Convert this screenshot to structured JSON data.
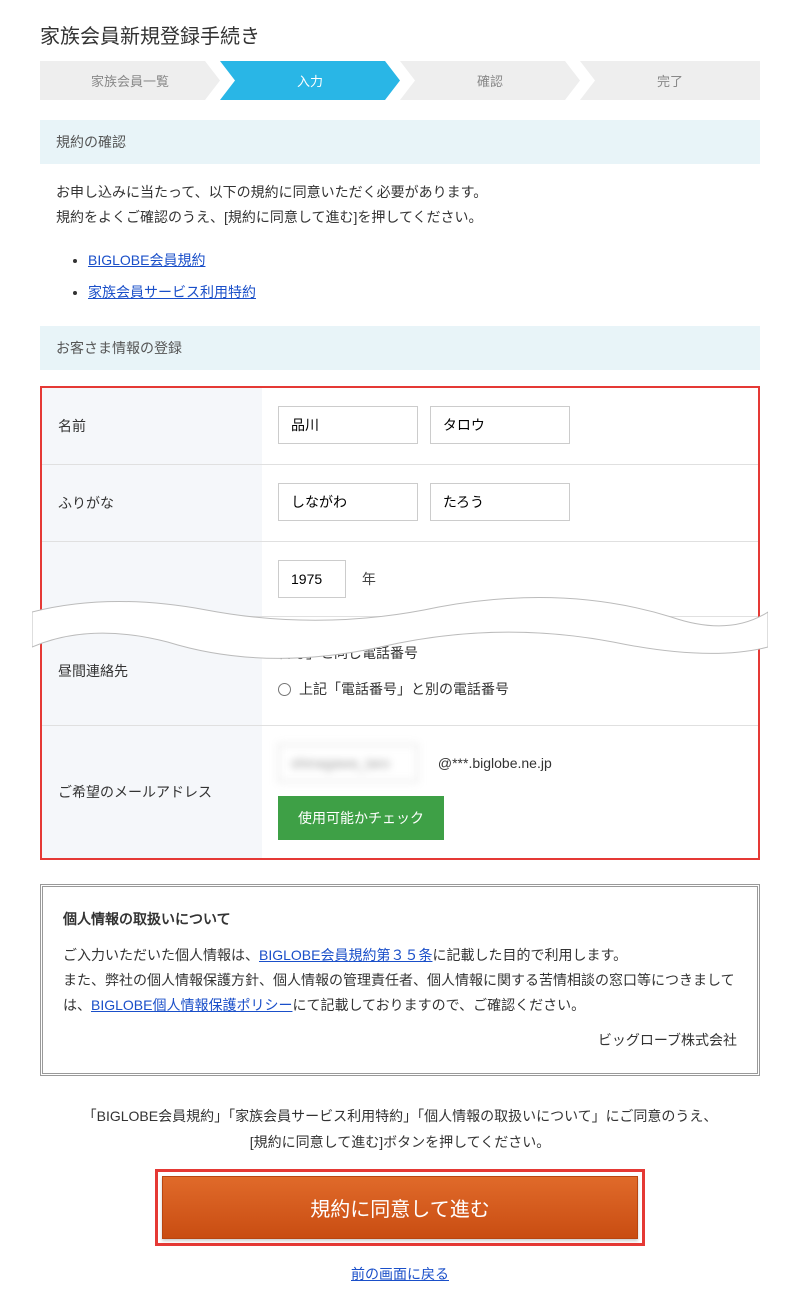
{
  "title": "家族会員新規登録手続き",
  "steps": [
    "家族会員一覧",
    "入力",
    "確認",
    "完了"
  ],
  "active_step_index": 1,
  "sections": {
    "terms_header": "規約の確認",
    "terms_intro_line1": "お申し込みに当たって、以下の規約に同意いただく必要があります。",
    "terms_intro_line2": "規約をよくご確認のうえ、[規約に同意して進む]を押してください。",
    "terms_links": [
      "BIGLOBE会員規約",
      "家族会員サービス利用特約"
    ],
    "customer_header": "お客さま情報の登録"
  },
  "form": {
    "name_label": "名前",
    "name_last": "品川",
    "name_first": "タロウ",
    "furigana_label": "ふりがな",
    "furigana_last": "しながわ",
    "furigana_first": "たろう",
    "year_value": "1975",
    "year_suffix": "年",
    "contact_label": "昼間連絡先",
    "contact_radio_same": "番号」と同じ電話番号",
    "contact_radio_diff": "上記「電話番号」と別の電話番号",
    "email_label": "ご希望のメールアドレス",
    "email_value": "shinagawa_taro",
    "email_domain": "@***.biglobe.ne.jp",
    "check_button": "使用可能かチェック"
  },
  "privacy": {
    "title": "個人情報の取扱いについて",
    "text1a": "ご入力いただいた個人情報は、",
    "link1": "BIGLOBE会員規約第３５条",
    "text1b": "に記載した目的で利用します。",
    "text2a": "また、弊社の個人情報保護方針、個人情報の管理責任者、個人情報に関する苦情相談の窓口等につきましては、",
    "link2": "BIGLOBE個人情報保護ポリシー",
    "text2b": "にて記載しておりますので、ご確認ください。",
    "company": "ビッグローブ株式会社"
  },
  "agree": {
    "note_line1": "「BIGLOBE会員規約」「家族会員サービス利用特約」「個人情報の取扱いについて」にご同意のうえ、",
    "note_line2": "[規約に同意して進む]ボタンを押してください。",
    "button": "規約に同意して進む",
    "back_link": "前の画面に戻る"
  }
}
